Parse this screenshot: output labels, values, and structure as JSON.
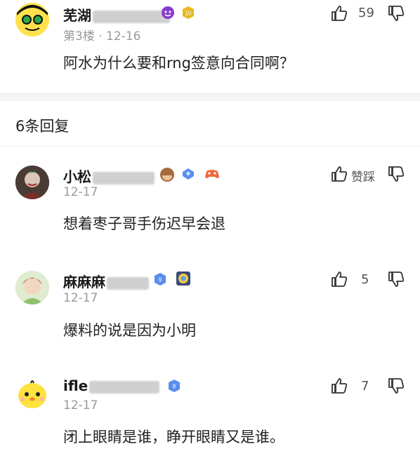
{
  "main_comment": {
    "username": "芜湖",
    "floor": "第3楼",
    "date": "12-16",
    "level": "10",
    "likes": "59",
    "text": "阿水为什么要和rng签意向合同啊？"
  },
  "replies_header": "6条回复",
  "replies": [
    {
      "username": "小松",
      "date": "12-17",
      "text": "想着枣子哥手伤迟早会退",
      "action_label": "赞踩",
      "likes": ""
    },
    {
      "username": "麻麻麻",
      "date": "12-17",
      "text": "爆料的说是因为小明",
      "level": "9",
      "likes": "5"
    },
    {
      "username": "ifle",
      "date": "12-17",
      "text": "闭上眼睛是谁，睁开眼睛又是谁。",
      "level": "8",
      "likes": "7"
    }
  ],
  "colors": {
    "accent": "#e8b820",
    "badge_blue": "#5b8def",
    "text": "#1a1a1a",
    "meta": "#9a9a9a"
  },
  "icons": [
    "thumb-up-icon",
    "thumb-down-icon",
    "devil-emoji-icon",
    "monkey-emoji-icon",
    "star-badge-icon"
  ]
}
